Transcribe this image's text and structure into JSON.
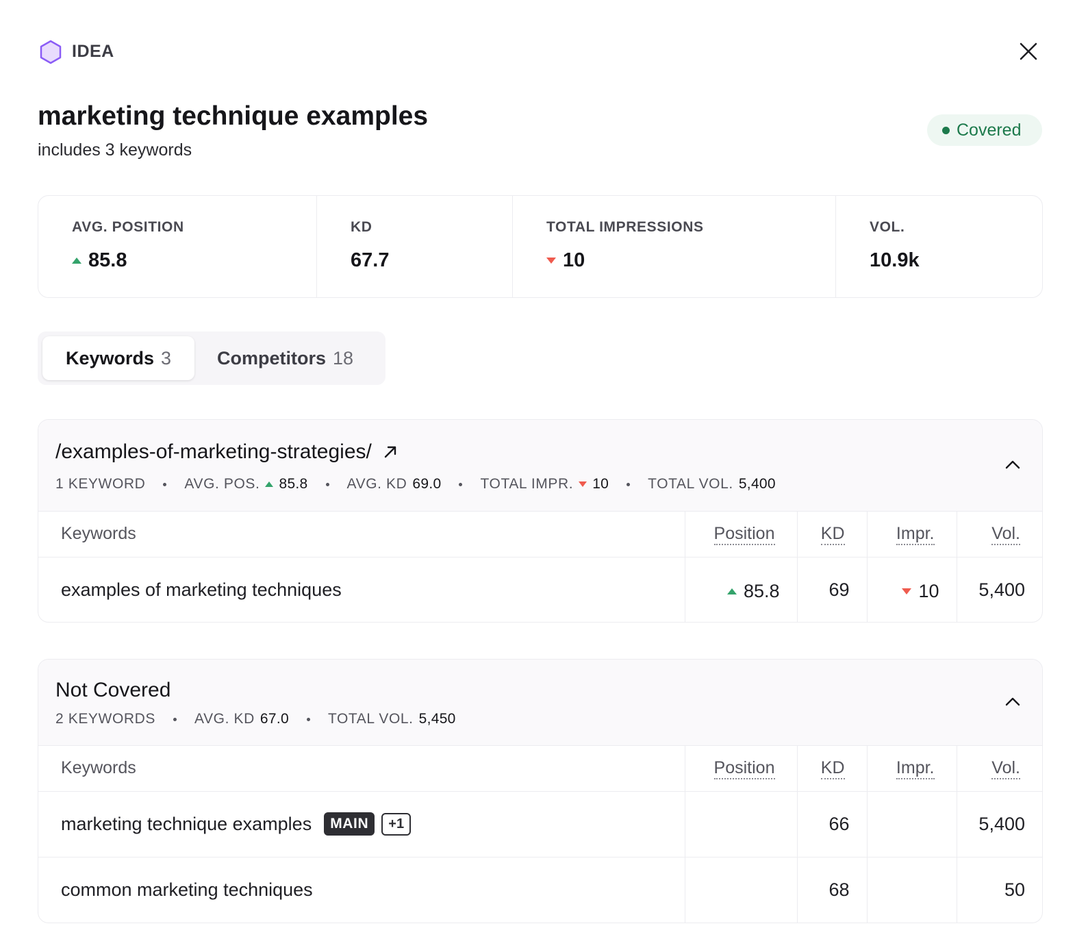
{
  "header": {
    "type_label": "IDEA",
    "type_icon": "hexagon-icon",
    "close_icon": "close-icon",
    "accent_color": "#8b5cf6"
  },
  "idea": {
    "title": "marketing technique examples",
    "subtitle": "includes 3 keywords",
    "status": "Covered",
    "status_color": "#1d7a4c"
  },
  "stats": [
    {
      "label": "AVG. POSITION",
      "value": "85.8",
      "trend": "up"
    },
    {
      "label": "KD",
      "value": "67.7",
      "trend": ""
    },
    {
      "label": "TOTAL IMPRESSIONS",
      "value": "10",
      "trend": "down"
    },
    {
      "label": "VOL.",
      "value": "10.9k",
      "trend": ""
    }
  ],
  "tabs": [
    {
      "label": "Keywords",
      "count": "3",
      "active": true
    },
    {
      "label": "Competitors",
      "count": "18",
      "active": false
    }
  ],
  "table_headers": {
    "keywords": "Keywords",
    "position": "Position",
    "kd": "KD",
    "impr": "Impr.",
    "vol": "Vol."
  },
  "groups": [
    {
      "title": "/examples-of-marketing-strategies/",
      "meta": {
        "keyword_count": "1 KEYWORD",
        "avg_pos_label": "AVG. POS.",
        "avg_pos_value": "85.8",
        "avg_kd_label": "AVG. KD",
        "avg_kd_value": "69.0",
        "total_impr_label": "TOTAL IMPR.",
        "total_impr_value": "10",
        "total_vol_label": "TOTAL VOL.",
        "total_vol_value": "5,400"
      },
      "rows": [
        {
          "keyword": "examples of marketing techniques",
          "position": "85.8",
          "kd": "69",
          "impr": "10",
          "vol": "5,400"
        }
      ]
    },
    {
      "title": "Not Covered",
      "meta": {
        "keyword_count": "2 KEYWORDS",
        "avg_kd_label": "AVG. KD",
        "avg_kd_value": "67.0",
        "total_vol_label": "TOTAL VOL.",
        "total_vol_value": "5,450"
      },
      "rows": [
        {
          "keyword": "marketing technique examples",
          "badge_main": "MAIN",
          "badge_extra": "+1",
          "position": "",
          "kd": "66",
          "impr": "",
          "vol": "5,400"
        },
        {
          "keyword": "common marketing techniques",
          "position": "",
          "kd": "68",
          "impr": "",
          "vol": "50"
        }
      ]
    }
  ]
}
